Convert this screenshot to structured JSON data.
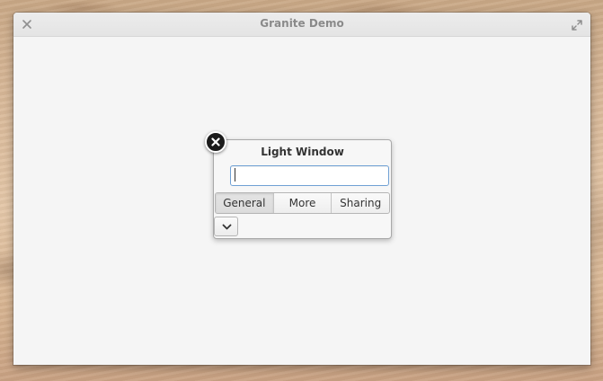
{
  "window": {
    "title": "Granite Demo"
  },
  "light_window": {
    "title": "Light Window",
    "entry_value": "",
    "entry_placeholder": "",
    "tabs": [
      {
        "label": "General",
        "active": true
      },
      {
        "label": "More",
        "active": false
      },
      {
        "label": "Sharing",
        "active": false
      }
    ]
  },
  "icons": {
    "window_close": "close-icon",
    "window_maximize": "maximize-icon",
    "light_window_close": "close-circle-icon",
    "expand": "chevron-down-icon"
  },
  "colors": {
    "entry_focus_border": "#6fa0d4",
    "close_badge": "#1b1b1b"
  }
}
